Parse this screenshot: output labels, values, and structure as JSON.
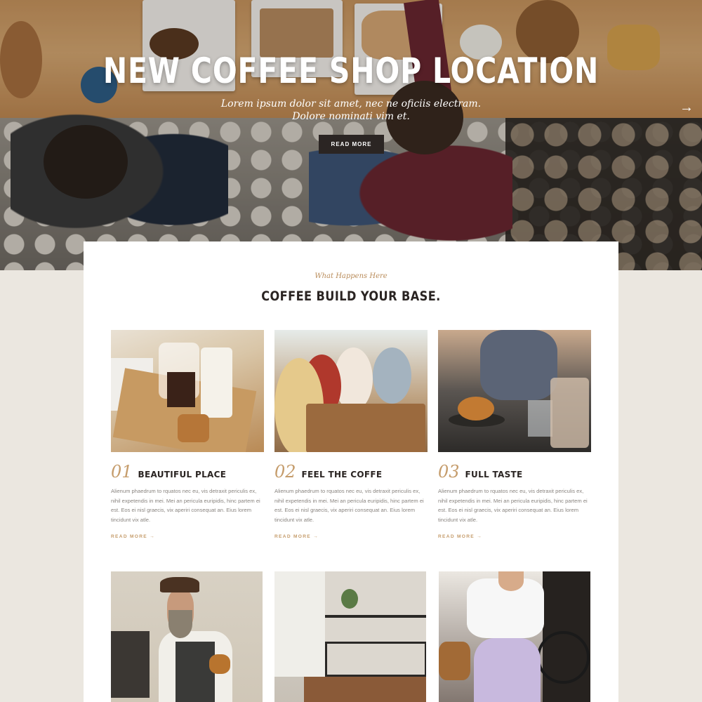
{
  "hero": {
    "title": "NEW COFFEE SHOP LOCATION",
    "subtitle_line1": "Lorem ipsum dolor sit amet, nec ne oficiis electram.",
    "subtitle_line2": "Dolore nominati vim et.",
    "button_label": "READ MORE",
    "next_arrow": "→"
  },
  "section": {
    "eyebrow": "What Happens Here",
    "title": "COFFEE BUILD YOUR BASE."
  },
  "features": [
    {
      "number": "01",
      "title": "BEAUTIFUL PLACE",
      "body": "Alienum phaedrum to rquatos nec eu, vis detraxit periculis ex, nihil expetendis in mei. Mei an pericula euripidis, hinc partem ei est. Eos ei nisl graecis, vix aperiri consequat an. Eius lorem tincidunt vix atle.",
      "link": "READ MORE  →"
    },
    {
      "number": "02",
      "title": "FEEL THE COFFE",
      "body": "Alienum phaedrum to rquatos nec eu, vis detraxit periculis ex, nihil expetendis in mei. Mei an pericula euripidis, hinc partem ei est. Eos ei nisl graecis, vix aperiri consequat an. Eius lorem tincidunt vix atle.",
      "link": "READ MORE  →"
    },
    {
      "number": "03",
      "title": "FULL TASTE",
      "body": "Alienum phaedrum to rquatos nec eu, vis detraxit periculis ex, nihil expetendis in mei. Mei an pericula euripidis, hinc partem ei est. Eos ei nisl graecis, vix aperiri consequat an. Eius lorem tincidunt vix atle.",
      "link": "READ MORE  →"
    }
  ],
  "colors": {
    "accent": "#c59c6b",
    "dark_button": "#2b2523",
    "page_background": "#ebe7e0",
    "card_background": "#ffffff"
  }
}
